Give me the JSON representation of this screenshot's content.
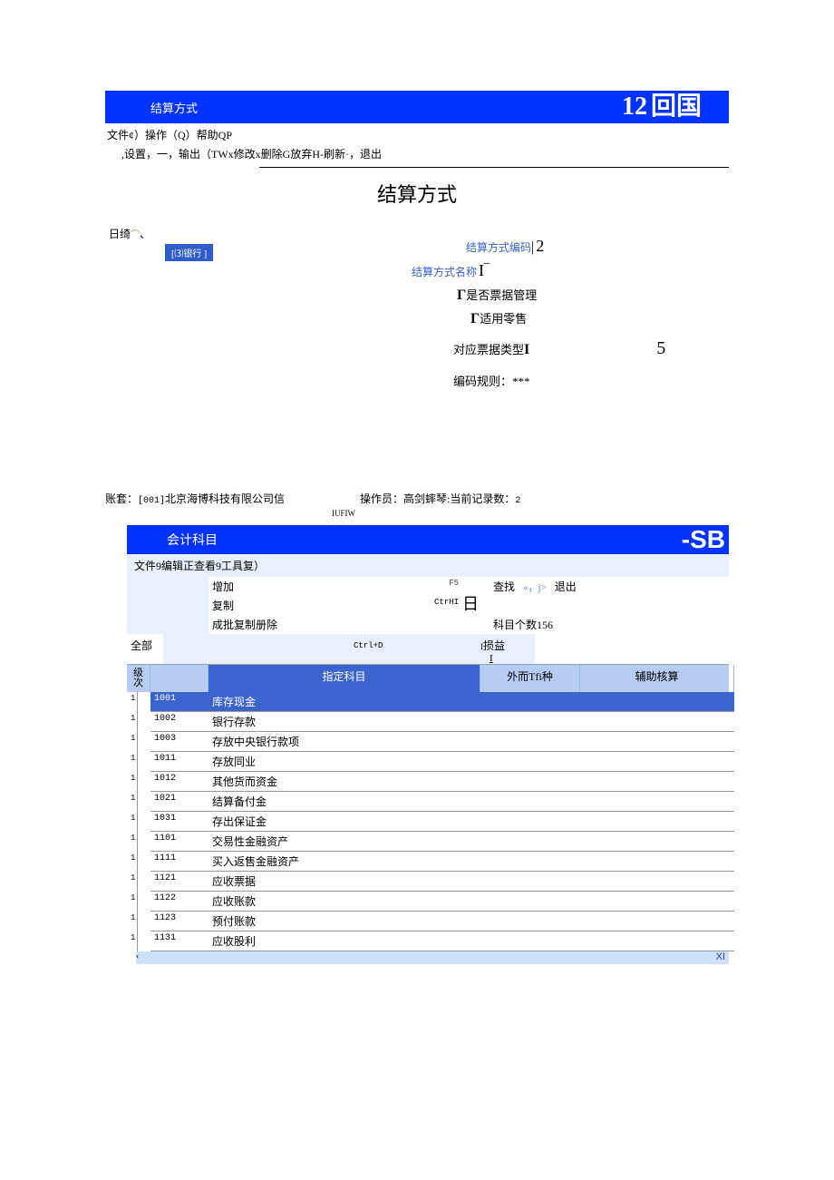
{
  "win1": {
    "title": "结算方式",
    "right_num": "12",
    "right_txt": "回国",
    "menu": "文件¢）操作（Q）帮助QP",
    "toolbar": ",设置，一，输出（TWx修改x删除G放弃H-刷新·，退出",
    "heading": "结算方式",
    "tree_root": "日绮",
    "tree_node": "[⑶银行 ]",
    "code_label": "结算方式编码",
    "code_value": "2",
    "name_label": "结算方式名称",
    "name_value": "I‾",
    "is_bill": "是否票据管理",
    "retail": "适用零售",
    "bill_type_label": "对应票据类型",
    "bill_type_i": "I",
    "bill_type_val": "5",
    "rule": "编码规则：***"
  },
  "win2": {
    "status_prefix": "账套：",
    "status_code": "[001]",
    "status_company": "北京海博科技有限公司信",
    "status_op": "操作员：高剑蟀琴:当前记录数：",
    "status_n": "2",
    "status_right": "IUFIW",
    "title": "会计科目",
    "title_right": "-SB",
    "menu": "文件9编辑正查看9工具复）",
    "add": "增加",
    "copy": "复制",
    "batch": "成批复制册除",
    "f5": "F5",
    "ctrlhi": "CtrHI",
    "ctrld": "Ctrl+D",
    "search": "查找",
    "nav": "«，j>",
    "exit": "退出",
    "count_label": "科目个数",
    "count_n": "156",
    "tab_losses": "损益",
    "filter_all": "全部",
    "col_level": "级次",
    "col_designate": "指定科目",
    "col_foreign": "外而Tfi种",
    "col_aux": "辅助核算",
    "rows": [
      {
        "lv": "1",
        "code": "1001",
        "name": "库存现金",
        "sel": true
      },
      {
        "lv": "1",
        "code": "1002",
        "name": "银行存款"
      },
      {
        "lv": "1",
        "code": "1003",
        "name": "存放中央银行款项"
      },
      {
        "lv": "1",
        "code": "1011",
        "name": "存放同业"
      },
      {
        "lv": "1",
        "code": "1012",
        "name": "其他货而资金"
      },
      {
        "lv": "1",
        "code": "1021",
        "name": "结算备付金"
      },
      {
        "lv": "1",
        "code": "1031",
        "name": "存出保证金"
      },
      {
        "lv": "1",
        "code": "1101",
        "name": "交易性金融资产"
      },
      {
        "lv": "1",
        "code": "1111",
        "name": "买入返售金融资产"
      },
      {
        "lv": "1",
        "code": "1121",
        "name": "应收票据"
      },
      {
        "lv": "1",
        "code": "1122",
        "name": "应收账款"
      },
      {
        "lv": "1",
        "code": "1123",
        "name": "预付账款"
      },
      {
        "lv": "1",
        "code": "1131",
        "name": "应收股利"
      }
    ],
    "xl": "XI"
  }
}
